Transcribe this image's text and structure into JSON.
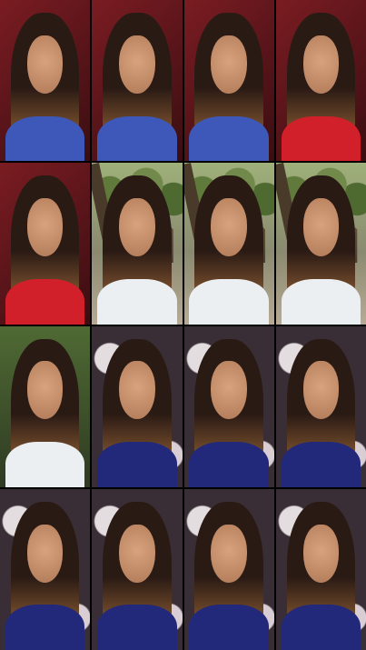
{
  "grid": {
    "rows": 4,
    "columns": 4
  },
  "frames": [
    {
      "scene": "indoor-red",
      "shirt": "blue-floral"
    },
    {
      "scene": "indoor-red",
      "shirt": "blue-floral"
    },
    {
      "scene": "indoor-red",
      "shirt": "blue-floral"
    },
    {
      "scene": "indoor-red",
      "shirt": "red"
    },
    {
      "scene": "indoor-red",
      "shirt": "red"
    },
    {
      "scene": "outdoor-trees",
      "shirt": "white"
    },
    {
      "scene": "outdoor-trees",
      "shirt": "white"
    },
    {
      "scene": "outdoor-trees",
      "shirt": "white"
    },
    {
      "scene": "outdoor-green",
      "shirt": "white"
    },
    {
      "scene": "floral-wall",
      "shirt": "navy"
    },
    {
      "scene": "floral-wall",
      "shirt": "navy"
    },
    {
      "scene": "floral-wall",
      "shirt": "navy"
    },
    {
      "scene": "floral-wall",
      "shirt": "navy"
    },
    {
      "scene": "floral-wall",
      "shirt": "navy"
    },
    {
      "scene": "floral-wall",
      "shirt": "navy"
    },
    {
      "scene": "floral-wall",
      "shirt": "navy"
    }
  ],
  "colors": {
    "background": "#000000",
    "indoor_red": "#7a1c22",
    "hair_dark": "#2a1a14",
    "hair_highlight": "#a06a3a",
    "skin": "#d8a27e",
    "shirt_blue_floral": "#3d58b8",
    "shirt_red": "#d2202a",
    "shirt_white": "#eceff2",
    "shirt_navy": "#22287a"
  }
}
